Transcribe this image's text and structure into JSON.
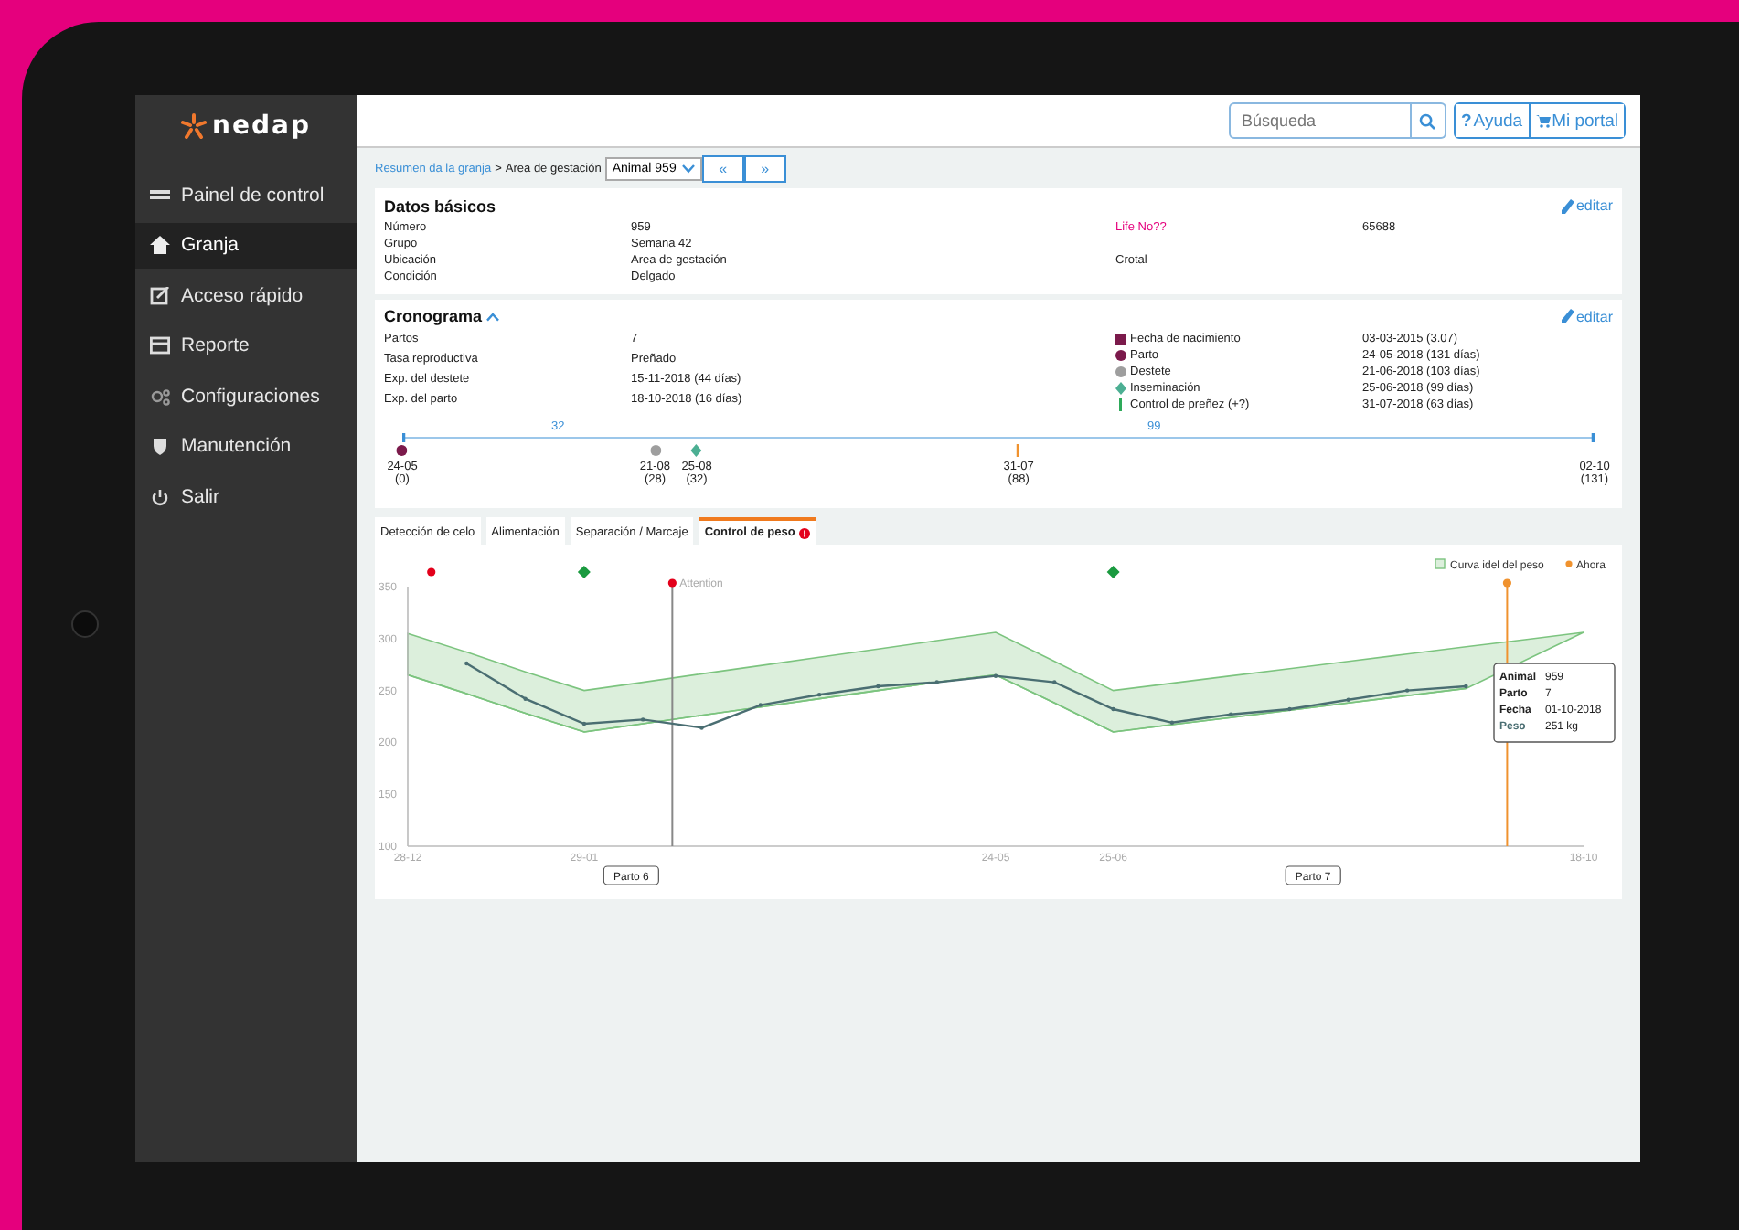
{
  "brand": {
    "name": "nedap"
  },
  "sidebar": {
    "items": [
      {
        "label": "Painel de control",
        "kind": "dashboard",
        "selected": false
      },
      {
        "label": "Granja",
        "kind": "home",
        "selected": true
      },
      {
        "label": "Acceso rápido",
        "kind": "edit",
        "selected": false
      },
      {
        "label": "Reporte",
        "kind": "report",
        "selected": false
      },
      {
        "label": "Configuraciones",
        "kind": "gears",
        "selected": false
      },
      {
        "label": "Manutención",
        "kind": "shield",
        "selected": false
      },
      {
        "label": "Salir",
        "kind": "power",
        "selected": false
      }
    ]
  },
  "topbar": {
    "search": {
      "placeholder": "Búsqueda"
    },
    "help": "Ayuda",
    "help_icon": "?",
    "portal": "Mi portal"
  },
  "breadcrumb": {
    "link": "Resumen da la granja",
    "separator": ">",
    "current": "Area de gestación",
    "animal_select": "Animal 959",
    "prev": "«",
    "next": "»"
  },
  "basic": {
    "title": "Datos básicos",
    "edit": "editar",
    "left": [
      {
        "label": "Número",
        "value": "959"
      },
      {
        "label": "Grupo",
        "value": "Semana 42"
      },
      {
        "label": "Ubicación",
        "value": "Area de gestación"
      },
      {
        "label": "Condición",
        "value": "Delgado"
      }
    ],
    "right": [
      {
        "label": "Life No??",
        "value": "65688",
        "highlighted": true
      },
      {
        "label": "Crotal",
        "highlighted": false
      }
    ]
  },
  "timeline": {
    "title": "Cronograma",
    "edit": "editar",
    "left": [
      {
        "label": "Partos",
        "value": "7"
      },
      {
        "label": "Tasa reproductiva",
        "value": "Preñado"
      },
      {
        "label": "Exp. del destete",
        "value": "15-11-2018 (44 días)"
      },
      {
        "label": "Exp. del parto",
        "value": "18-10-2018 (16 días)"
      }
    ],
    "legend": [
      {
        "kind": "square",
        "label": "Fecha de nacimiento",
        "value": "03-03-2015 (3.07)",
        "color": "#7b1a4b"
      },
      {
        "kind": "dot",
        "label": "Parto",
        "value": "24-05-2018 (131 días)",
        "color": "#7b1a4b"
      },
      {
        "kind": "dot",
        "label": "Destete",
        "value": "21-06-2018 (103 días)",
        "color": "#9e9e9e"
      },
      {
        "kind": "diamond",
        "label": "Inseminación",
        "value": "25-06-2018 (99 días)",
        "color": "#4caf93"
      },
      {
        "kind": "bar",
        "label": "Control de preñez (+?)",
        "value": "31-07-2018 (63 días)",
        "color": "#2eaa5a"
      }
    ],
    "segments": [
      "32",
      "99"
    ],
    "ticks": [
      {
        "kind": "dot",
        "color": "#7b1a4b",
        "date": "24-05",
        "days": "(0)"
      },
      {
        "kind": "dot",
        "color": "#9e9e9e",
        "date": "21-08",
        "days": "(28)"
      },
      {
        "kind": "diamond",
        "color": "#4caf93",
        "date": "25-08",
        "days": "(32)"
      },
      {
        "kind": "bar",
        "color": "#f0922e",
        "date": "31-07",
        "days": "(88)"
      },
      {
        "kind": "none",
        "date": "02-10",
        "days": "(131)"
      }
    ]
  },
  "tabs": [
    {
      "label": "Detección de celo",
      "selected": false,
      "alert": false
    },
    {
      "label": "Alimentación",
      "selected": false,
      "alert": false
    },
    {
      "label": "Separación / Marcaje",
      "selected": false,
      "alert": false
    },
    {
      "label": "Control de peso",
      "selected": true,
      "alert": true
    }
  ],
  "weight": {
    "now_label": "Ahora",
    "markers": [
      {
        "kind": "alert"
      },
      {
        "kind": "insemination"
      },
      {
        "kind": "alert",
        "label": "Attention"
      },
      {
        "kind": "insemination"
      },
      {
        "kind": "now"
      }
    ],
    "partos": [
      "Parto 6",
      "Parto 7"
    ],
    "tooltip": [
      {
        "label": "Animal",
        "value": "959"
      },
      {
        "label": "Parto",
        "value": "7"
      },
      {
        "label": "Fecha",
        "value": "01-10-2018"
      },
      {
        "value": "251 kg"
      }
    ],
    "chart_data": {
      "type": "line",
      "categories": [
        "28-12",
        null,
        null,
        "29-01",
        null,
        null,
        null,
        null,
        null,
        null,
        "24-05",
        null,
        "25-06",
        null,
        null,
        null,
        null,
        null,
        null,
        null,
        "18-10"
      ],
      "ylim": [
        100,
        350
      ],
      "yticks": [
        100,
        150,
        200,
        250,
        300,
        350
      ],
      "series": [
        {
          "name": "Curva idel del peso",
          "type": "area",
          "color": "#7cc47f",
          "values": [
            305,
            287,
            268,
            250,
            258,
            266,
            274,
            282,
            290,
            298,
            306,
            278,
            250,
            257,
            264,
            271,
            278,
            285,
            292,
            299,
            306
          ]
        },
        {
          "type": "line",
          "color": "#7cc47f",
          "values": [
            265,
            247,
            228,
            210,
            218,
            226,
            234,
            242,
            250,
            258,
            265,
            238,
            210,
            217,
            224,
            231,
            238,
            245,
            252,
            null,
            null
          ]
        },
        {
          "name": "Peso",
          "color": "#4a6e72",
          "values": [
            null,
            276,
            242,
            218,
            222,
            214,
            236,
            246,
            254,
            258,
            264,
            258,
            232,
            219,
            227,
            232,
            241,
            250,
            254,
            null,
            null
          ]
        }
      ]
    }
  }
}
